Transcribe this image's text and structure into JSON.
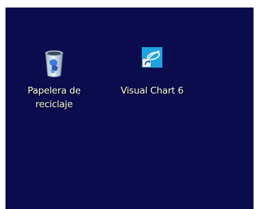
{
  "desktop": {
    "background_color": "#0a0c4e",
    "icons": [
      {
        "name": "recycle-bin",
        "icon": "recycle-bin-icon",
        "label_line1": "Papelera de",
        "label_line2": "reciclaje"
      },
      {
        "name": "visual-chart",
        "icon": "visual-chart-app-icon",
        "label_line1": "Visual Chart 6",
        "accent_color": "#1fa3df"
      }
    ]
  }
}
